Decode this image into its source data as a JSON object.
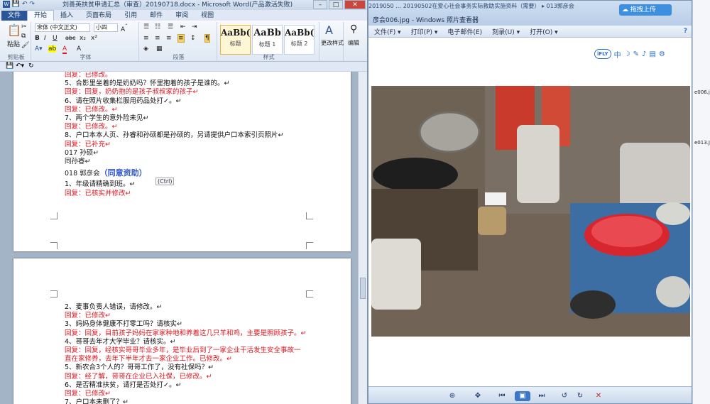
{
  "word": {
    "title": "刘善英扶贫申请汇总（审查）20190718.docx - Microsoft Word(产品激活失败)",
    "tabs": [
      "文件",
      "开始",
      "插入",
      "页面布局",
      "引用",
      "邮件",
      "审阅",
      "视图"
    ],
    "active_tab": "开始",
    "ribbon": {
      "paste_label": "粘贴",
      "clipboard_label": "剪贴板",
      "font_name": "宋体 (中文正文)",
      "font_size": "小四",
      "font_group_label": "字体",
      "paragraph_label": "段落",
      "styles_label": "样式",
      "styles": [
        {
          "preview": "AaBb(",
          "name": "标题"
        },
        {
          "preview": "AaBb",
          "name": "标题 1"
        },
        {
          "preview": "AaBb(",
          "name": "标题 2"
        }
      ],
      "change_styles": "更改样式",
      "edit_label": "编辑",
      "quick_buttons": [
        "B",
        "I",
        "U",
        "abc",
        "x₂",
        "x²"
      ]
    },
    "page1_lines": [
      {
        "text": "回复：已修改。",
        "kind": "red"
      },
      {
        "text": "5、合影里坐着的是奶奶吗？怀里抱着的孩子是谁的。↵",
        "kind": "black"
      },
      {
        "text": "回复：回复，奶奶抱的是孩子叔叔家的孩子↵",
        "kind": "red"
      },
      {
        "text": "6、请在照片收集栏服用药品处打✓。↵",
        "kind": "black"
      },
      {
        "text": "回复：已修改。↵",
        "kind": "red"
      },
      {
        "text": "7、两个学生的意外险未见↵",
        "kind": "black"
      },
      {
        "text": "回复：已修改。↵",
        "kind": "red"
      },
      {
        "text": "8、户口本本人页、孙睿和孙硕都是孙硕的，另请提供户口本索引页照片↵",
        "kind": "black"
      },
      {
        "text": "回复：已补充↵",
        "kind": "red"
      },
      {
        "text": "017 孙硕↵",
        "kind": "heading"
      },
      {
        "text": "同孙睿↵",
        "kind": "heading"
      }
    ],
    "page1_heading_prefix": "018 郭彦会",
    "page1_heading_highlight": "（同意资助）",
    "page1_after": [
      {
        "text": "1、年级请精确到班。↵",
        "kind": "black"
      },
      {
        "text": "回复：已核实并修改↵",
        "kind": "red"
      }
    ],
    "ctrl_tag": "(Ctrl)",
    "page2_lines": [
      {
        "text": "2、麦事负责人错误，请修改。↵",
        "kind": "black"
      },
      {
        "text": "回复：已修改↵",
        "kind": "red"
      },
      {
        "text": "3、妈妈身体健康不打零工吗？请核实↵",
        "kind": "black"
      },
      {
        "text": "回复：回复，目前孩子妈妈在家家种地和养着这几只羊和鸡，主要是照顾孩子。↵",
        "kind": "red"
      },
      {
        "text": "4、哥哥去年才大学毕业？请核实。↵",
        "kind": "black"
      },
      {
        "text": "回复：回复，经核实哥哥毕业多年，是毕业后到了一家企业干活发生安全事故一",
        "kind": "red"
      },
      {
        "text": "直在家修养，去年下半年才去一家企业工作。已修改。↵",
        "kind": "red"
      },
      {
        "text": "5、新农合3个人的？哥哥工作了，没有社保吗？↵",
        "kind": "black"
      },
      {
        "text": "回复：经了解，哥哥在企业已入社保，已修改。↵",
        "kind": "red"
      },
      {
        "text": "6、是否精准扶贫，请打是否处打✓。↵",
        "kind": "black"
      },
      {
        "text": "回复：已修改↵",
        "kind": "red"
      },
      {
        "text": "7、户口本未删了？↵",
        "kind": "black"
      }
    ]
  },
  "viewer": {
    "bg_tabs": "2019050 … 20190502在爱心社会事务实际救助实施资料（需要）  ▸  013郭彦会",
    "title": "彦会006.jpg - Windows 照片查看器",
    "menu": [
      "文件(F) ▾",
      "打印(P) ▾",
      "电子邮件(E)",
      "刻录(U) ▾",
      "打开(O) ▾"
    ],
    "ifly_logo": "iFLY",
    "ifly_items": [
      "中",
      "☽",
      "✎",
      "♪",
      "▤",
      "⚙"
    ],
    "help": "?"
  },
  "upload_button": "拖拽上传",
  "strip_files": [
    "e006.jp",
    "e013.JP"
  ],
  "colors": {
    "word_blue": "#2a5699",
    "reply_red": "#e0141e",
    "highlight_blue": "#2f57c9"
  }
}
